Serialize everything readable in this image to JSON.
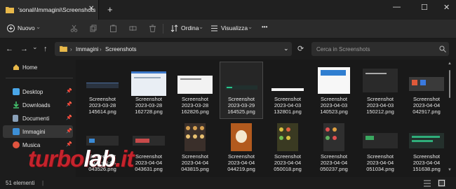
{
  "window": {
    "tab_title": "'sonali\\Immagini\\Screenshots",
    "tab_close": "✕",
    "tab_add": "+",
    "minimize": "—",
    "maximize": "☐",
    "close": "✕"
  },
  "toolbar": {
    "new_label": "Nuovo",
    "new_caret": "⌄",
    "sort_label": "Ordina",
    "sort_caret": "⌄",
    "view_label": "Visualizza",
    "view_caret": "⌄",
    "more_label": "•••"
  },
  "nav": {
    "back": "←",
    "forward": "→",
    "recent": "⌄",
    "up": "↑",
    "breadcrumb": [
      "Immagini",
      "Screenshots"
    ],
    "sep": "›",
    "dropdown": "⌄",
    "refresh": "⟳"
  },
  "search": {
    "placeholder": "Cerca in Screenshots"
  },
  "sidebar": {
    "items": [
      {
        "label": "Home",
        "icon": "home-icon"
      },
      {
        "label": "Desktop",
        "icon": "desktop-icon",
        "pin": "📌"
      },
      {
        "label": "Downloads",
        "icon": "download-icon",
        "pin": "📌"
      },
      {
        "label": "Documenti",
        "icon": "document-icon",
        "pin": "📌"
      },
      {
        "label": "Immagini",
        "icon": "image-icon",
        "pin": "📌"
      },
      {
        "label": "Musica",
        "icon": "music-icon",
        "pin": "📌"
      }
    ]
  },
  "files": [
    {
      "line1": "Screenshot",
      "line2": "2023-03-28",
      "line3": "145614.png"
    },
    {
      "line1": "Screenshot",
      "line2": "2023-03-28",
      "line3": "162728.png"
    },
    {
      "line1": "Screenshot",
      "line2": "2023-03-28",
      "line3": "162826.png"
    },
    {
      "line1": "Screenshot",
      "line2": "2023-03-29",
      "line3": "164525.png"
    },
    {
      "line1": "Screenshot",
      "line2": "2023-04-03",
      "line3": "132801.png"
    },
    {
      "line1": "Screenshot",
      "line2": "2023-04-03",
      "line3": "140523.png"
    },
    {
      "line1": "Screenshot",
      "line2": "2023-04-03",
      "line3": "150212.png"
    },
    {
      "line1": "Screenshot",
      "line2": "2023-04-04",
      "line3": "042917.png"
    },
    {
      "line1": "Screenshot",
      "line2": "2023-04-04",
      "line3": "043526.png"
    },
    {
      "line1": "Screenshot",
      "line2": "2023-04-04",
      "line3": "043631.png"
    },
    {
      "line1": "Screenshot",
      "line2": "2023-04-04",
      "line3": "043815.png"
    },
    {
      "line1": "Screenshot",
      "line2": "2023-04-04",
      "line3": "044219.png"
    },
    {
      "line1": "Screenshot",
      "line2": "2023-04-04",
      "line3": "050018.png"
    },
    {
      "line1": "Screenshot",
      "line2": "2023-04-04",
      "line3": "050237.png"
    },
    {
      "line1": "Screenshot",
      "line2": "2023-04-04",
      "line3": "051034.png"
    },
    {
      "line1": "Screenshot",
      "line2": "2023-04-04",
      "line3": "151638.png"
    }
  ],
  "status": {
    "count": "51 elementi",
    "sep": "|"
  },
  "watermark": {
    "part1": "turbo",
    "part2": "lab",
    "part3": ".it"
  },
  "colors": {
    "accent": "#4cc2ff",
    "folder": "#e8b84a",
    "watermark": "#c5232c"
  }
}
